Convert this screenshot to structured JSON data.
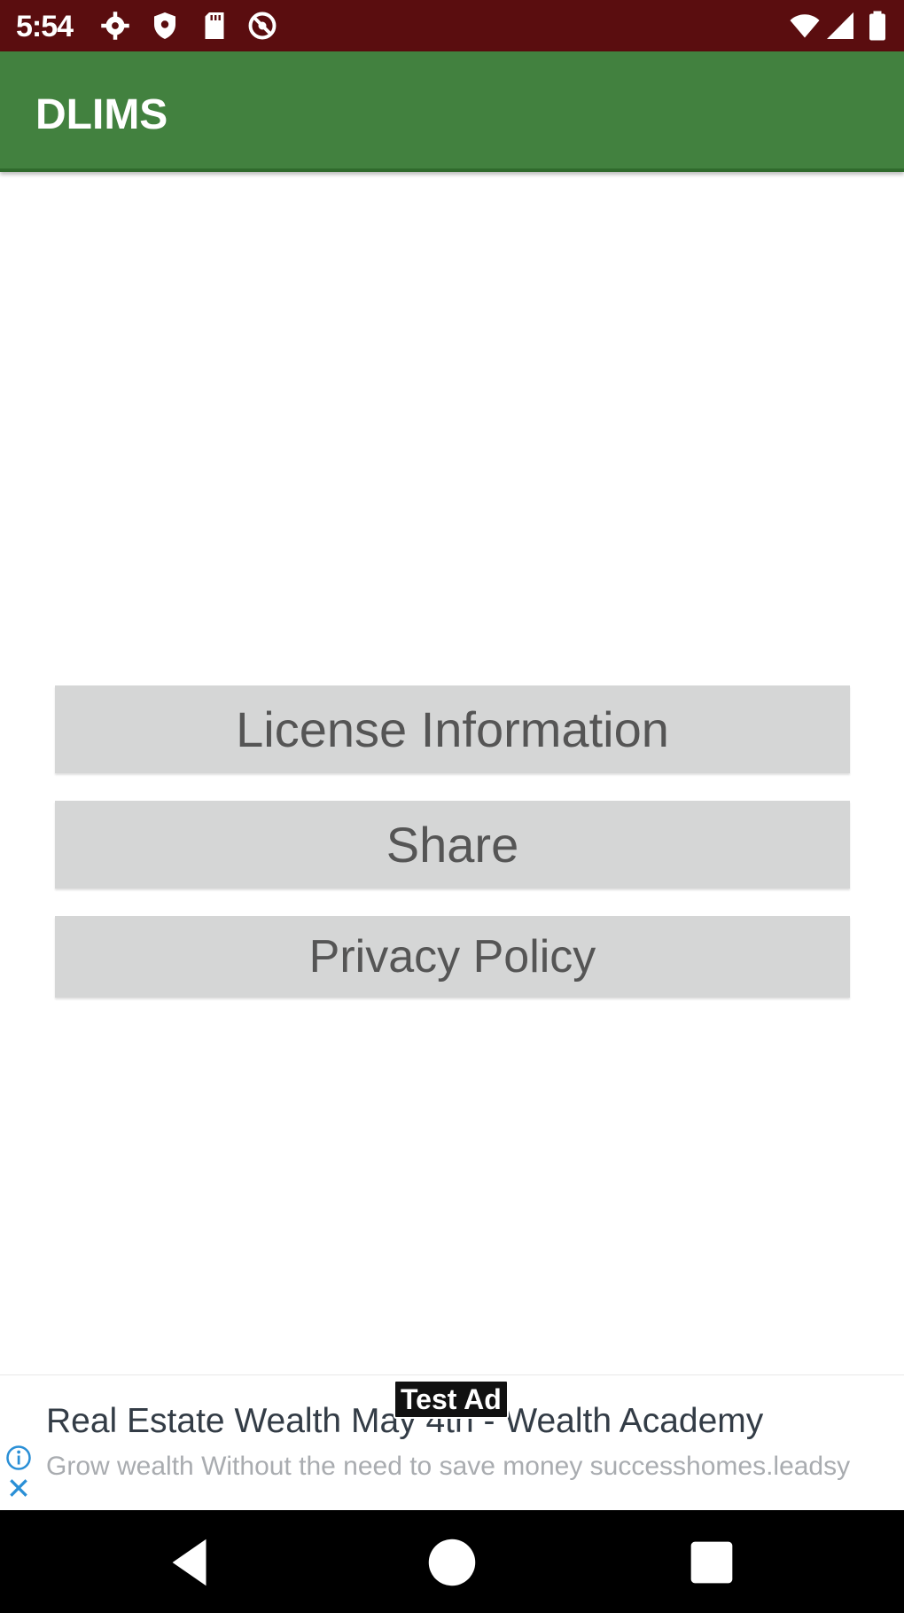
{
  "status_bar": {
    "time": "5:54",
    "left_icons": [
      "gear-icon",
      "shield-icon",
      "sd-card-icon",
      "no-sync-icon"
    ],
    "right_icons": [
      "wifi-icon",
      "signal-icon",
      "battery-icon"
    ],
    "background": "#5a0d0f"
  },
  "app_bar": {
    "title": "DLIMS",
    "background": "#42813f"
  },
  "menu": {
    "license_label": "License Information",
    "share_label": "Share",
    "privacy_label": "Privacy Policy"
  },
  "ad": {
    "badge": "Test Ad",
    "title": "Real Estate Wealth May 4th - Wealth Academy",
    "description": "Grow wealth Without the need to save money successhomes.leadsy"
  },
  "nav_bar": {
    "buttons": [
      "back-icon",
      "home-icon",
      "recents-icon"
    ]
  }
}
